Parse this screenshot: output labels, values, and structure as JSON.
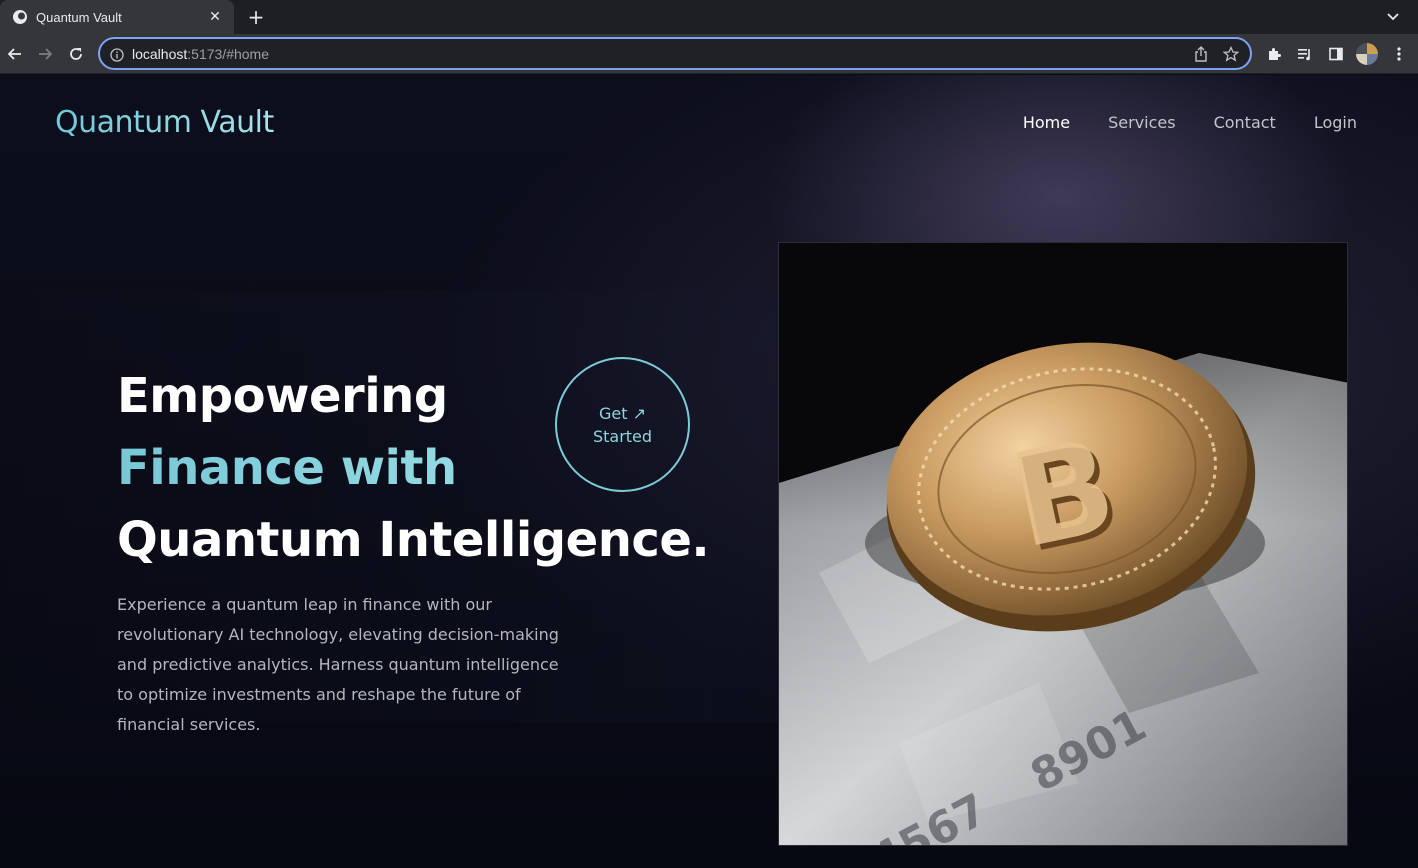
{
  "browser": {
    "tab_title": "Quantum Vault",
    "tab_close": "✕",
    "new_tab": "+",
    "url_host": "localhost",
    "url_rest": ":5173/#home"
  },
  "site": {
    "logo": "Quantum Vault",
    "nav": [
      {
        "label": "Home",
        "active": true
      },
      {
        "label": "Services",
        "active": false
      },
      {
        "label": "Contact",
        "active": false
      },
      {
        "label": "Login",
        "active": false
      }
    ],
    "hero": {
      "title_line1": "Empowering",
      "title_line2": "Finance with",
      "title_line3": "Quantum Intelligence.",
      "cta_line1": "Get ↗",
      "cta_line2": "Started",
      "description": "Experience a quantum leap in finance with our revolutionary AI technology, elevating decision-making and predictive analytics. Harness quantum intelligence to optimize investments and reshape the future of financial services."
    },
    "hero_image": "bitcoin-coin-on-credit-card"
  },
  "colors": {
    "accent": "#7ccbd6",
    "background": "#0a0c16",
    "omnibox_focus": "#7ca3f5"
  }
}
